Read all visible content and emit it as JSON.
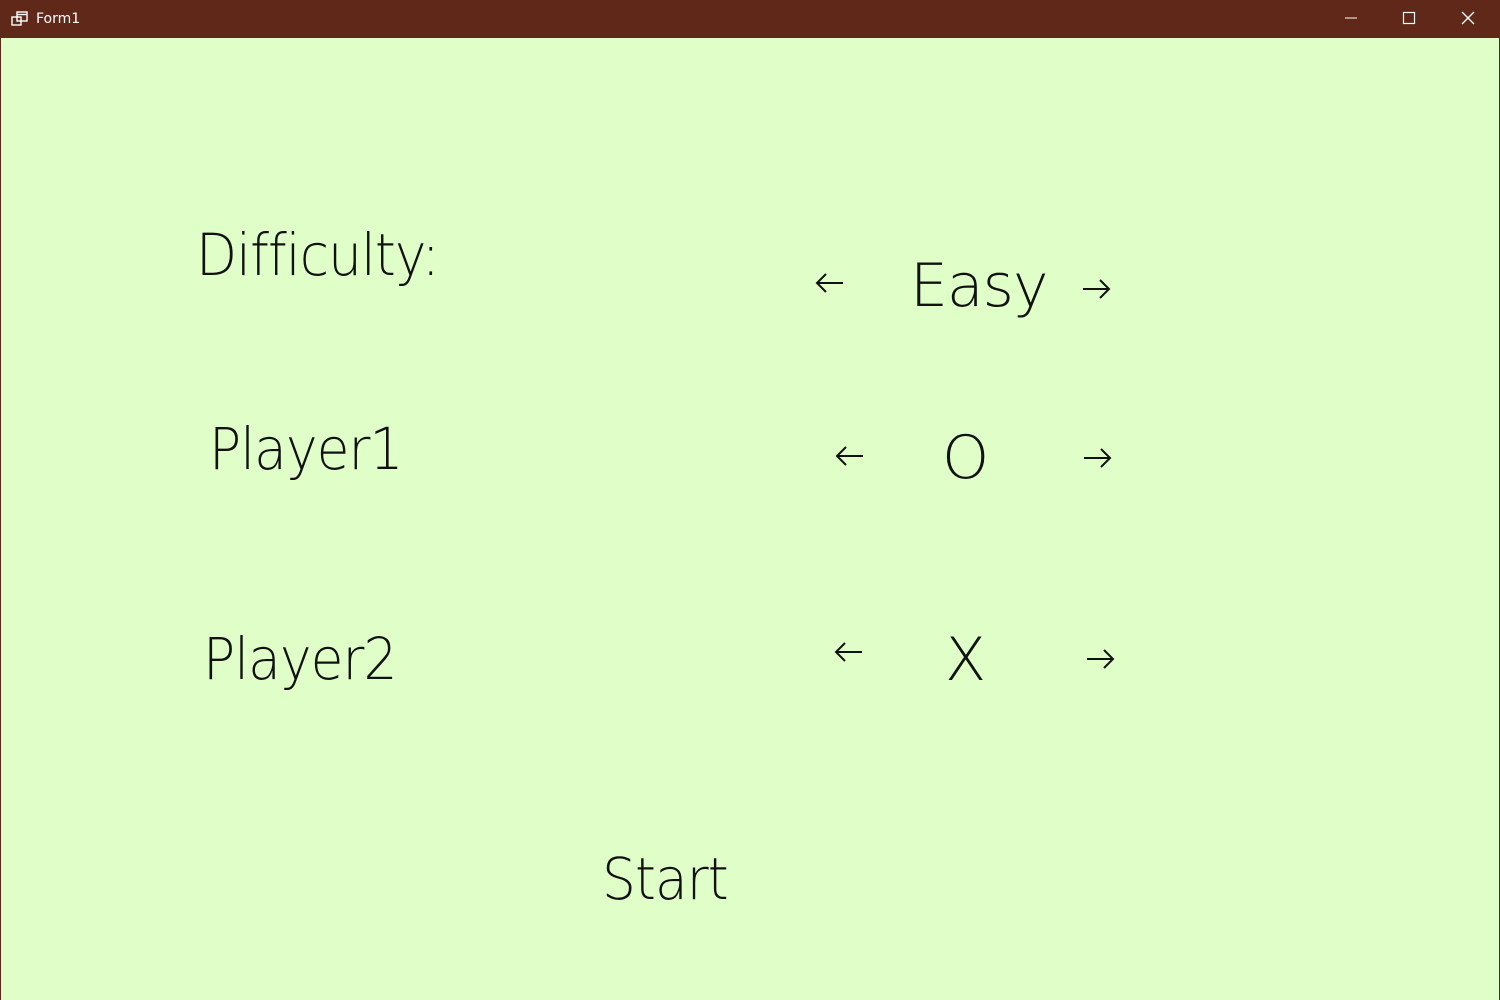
{
  "window": {
    "title": "Form1",
    "app_icon": "window-restore-app-icon",
    "controls": {
      "minimize_icon": "minimize-icon",
      "maximize_icon": "maximize-icon",
      "close_icon": "close-icon"
    }
  },
  "colors": {
    "titlebar": "#5f2819",
    "background": "#e0ffc8",
    "text": "#111111"
  },
  "settings": {
    "difficulty": {
      "label": "Difficulty:",
      "value": "Easy",
      "prev_icon": "arrow-left-icon",
      "next_icon": "arrow-right-icon"
    },
    "player1": {
      "label": "Player1",
      "value": "O",
      "prev_icon": "arrow-left-icon",
      "next_icon": "arrow-right-icon"
    },
    "player2": {
      "label": "Player2",
      "value": "X",
      "prev_icon": "arrow-left-icon",
      "next_icon": "arrow-right-icon"
    }
  },
  "start": {
    "label": "Start"
  }
}
